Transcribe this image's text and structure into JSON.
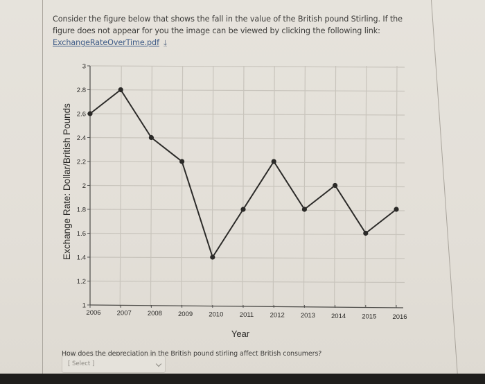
{
  "intro": {
    "text_line": "Consider the figure below that shows the fall in the value of the British pound Stirling. If the figure does not appear for you the image can be viewed by clicking the following link:",
    "link_label": "ExchangeRateOverTime.pdf",
    "download_icon": "download-icon"
  },
  "chart_data": {
    "type": "line",
    "title": "",
    "xlabel": "Year",
    "ylabel": "Exchange Rate: Dollar/British Pounds",
    "x": [
      2006,
      2007,
      2008,
      2009,
      2010,
      2011,
      2012,
      2013,
      2014,
      2015,
      2016
    ],
    "x_tick_labels": [
      "2006",
      "2007",
      "2008",
      "2009",
      "2010",
      "2011",
      "2012",
      "2013",
      "2014",
      "2015",
      "2016"
    ],
    "series": [
      {
        "name": "Exchange Rate",
        "values": [
          2.6,
          2.8,
          2.4,
          2.2,
          1.4,
          1.8,
          2.2,
          1.8,
          2.0,
          1.6,
          1.8
        ],
        "color": "#2b2a28"
      }
    ],
    "ylim": [
      1,
      3
    ],
    "xlim": [
      2006,
      2016
    ],
    "y_ticks": [
      1,
      1.2,
      1.4,
      1.6,
      1.8,
      2,
      2.2,
      2.4,
      2.6,
      2.8,
      3
    ],
    "y_tick_labels": [
      "1",
      "1.2",
      "1.4",
      "1.6",
      "1.8",
      "2",
      "2.2",
      "2.4",
      "2.6",
      "2.8",
      "3"
    ],
    "grid": true,
    "legend": "none"
  },
  "question": {
    "text": "How does the depreciation in the British pound stirling affect British consumers?",
    "select_value": "[ Select ]"
  },
  "colors": {
    "link": "#3e5b87",
    "grid": "#c8c4bc",
    "line": "#2b2a28",
    "background": "#e3dfd8"
  }
}
